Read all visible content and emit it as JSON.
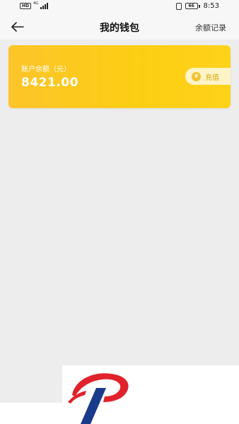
{
  "status_bar": {
    "hd_badge": "HD",
    "network_type": "4G",
    "battery_level": "66",
    "time": "8:53"
  },
  "nav": {
    "title": "我的钱包",
    "right_link": "余额记录",
    "back_icon": "arrow-left-icon"
  },
  "wallet": {
    "balance_label": "账户余额（元）",
    "balance_amount": "8421.00",
    "recharge_label": "充值",
    "coin_symbol": "¥"
  },
  "colors": {
    "card_gradient_start": "#fcc52a",
    "card_gradient_end": "#ffd21b",
    "recharge_bg": "#fff4c8",
    "recharge_text": "#d6a300",
    "logo_red": "#e0222b",
    "logo_blue": "#1a3a8c"
  }
}
